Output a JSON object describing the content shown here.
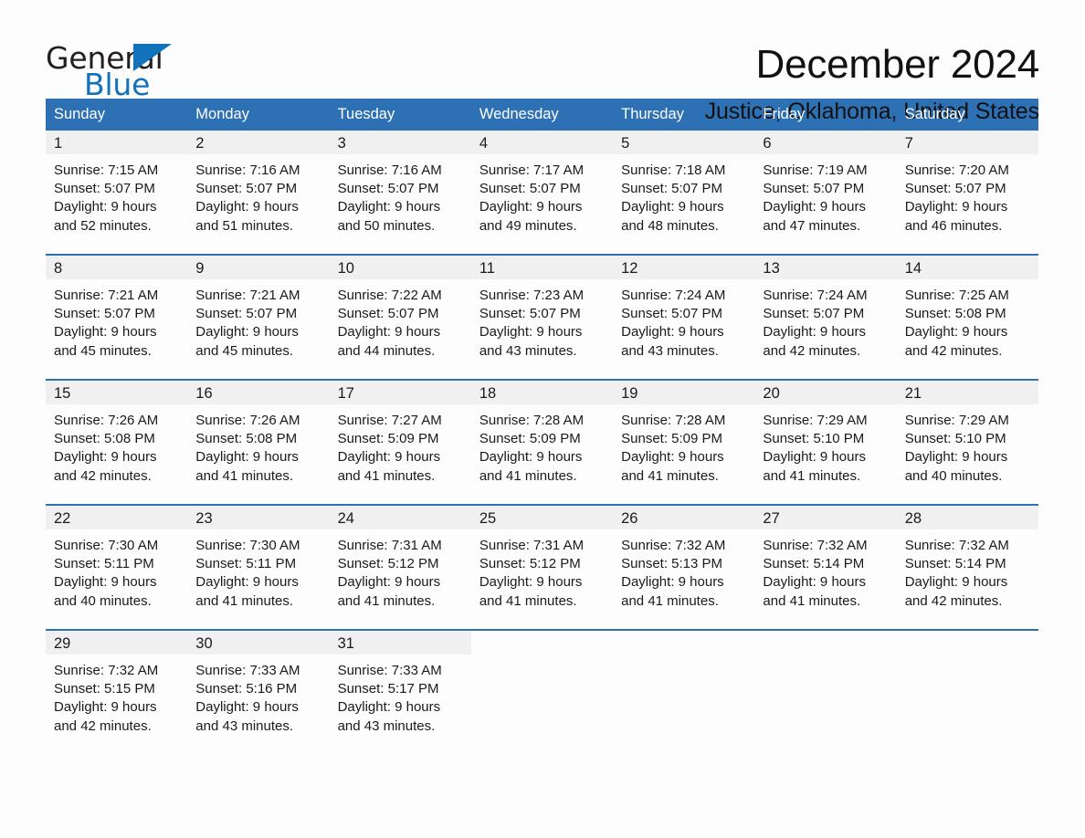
{
  "brand": {
    "name_part1": "General",
    "name_part2": "Blue"
  },
  "header": {
    "title": "December 2024",
    "subtitle": "Justice, Oklahoma, United States"
  },
  "colors": {
    "header_blue": "#2e70b4",
    "logo_blue": "#1272bb",
    "day_band_gray": "#f0f0f0",
    "page_background": "#fdfdfd"
  },
  "weekdays": [
    "Sunday",
    "Monday",
    "Tuesday",
    "Wednesday",
    "Thursday",
    "Friday",
    "Saturday"
  ],
  "weeks": [
    [
      {
        "day": "1",
        "sunrise": "Sunrise: 7:15 AM",
        "sunset": "Sunset: 5:07 PM",
        "daylight_line1": "Daylight: 9 hours",
        "daylight_line2": "and 52 minutes."
      },
      {
        "day": "2",
        "sunrise": "Sunrise: 7:16 AM",
        "sunset": "Sunset: 5:07 PM",
        "daylight_line1": "Daylight: 9 hours",
        "daylight_line2": "and 51 minutes."
      },
      {
        "day": "3",
        "sunrise": "Sunrise: 7:16 AM",
        "sunset": "Sunset: 5:07 PM",
        "daylight_line1": "Daylight: 9 hours",
        "daylight_line2": "and 50 minutes."
      },
      {
        "day": "4",
        "sunrise": "Sunrise: 7:17 AM",
        "sunset": "Sunset: 5:07 PM",
        "daylight_line1": "Daylight: 9 hours",
        "daylight_line2": "and 49 minutes."
      },
      {
        "day": "5",
        "sunrise": "Sunrise: 7:18 AM",
        "sunset": "Sunset: 5:07 PM",
        "daylight_line1": "Daylight: 9 hours",
        "daylight_line2": "and 48 minutes."
      },
      {
        "day": "6",
        "sunrise": "Sunrise: 7:19 AM",
        "sunset": "Sunset: 5:07 PM",
        "daylight_line1": "Daylight: 9 hours",
        "daylight_line2": "and 47 minutes."
      },
      {
        "day": "7",
        "sunrise": "Sunrise: 7:20 AM",
        "sunset": "Sunset: 5:07 PM",
        "daylight_line1": "Daylight: 9 hours",
        "daylight_line2": "and 46 minutes."
      }
    ],
    [
      {
        "day": "8",
        "sunrise": "Sunrise: 7:21 AM",
        "sunset": "Sunset: 5:07 PM",
        "daylight_line1": "Daylight: 9 hours",
        "daylight_line2": "and 45 minutes."
      },
      {
        "day": "9",
        "sunrise": "Sunrise: 7:21 AM",
        "sunset": "Sunset: 5:07 PM",
        "daylight_line1": "Daylight: 9 hours",
        "daylight_line2": "and 45 minutes."
      },
      {
        "day": "10",
        "sunrise": "Sunrise: 7:22 AM",
        "sunset": "Sunset: 5:07 PM",
        "daylight_line1": "Daylight: 9 hours",
        "daylight_line2": "and 44 minutes."
      },
      {
        "day": "11",
        "sunrise": "Sunrise: 7:23 AM",
        "sunset": "Sunset: 5:07 PM",
        "daylight_line1": "Daylight: 9 hours",
        "daylight_line2": "and 43 minutes."
      },
      {
        "day": "12",
        "sunrise": "Sunrise: 7:24 AM",
        "sunset": "Sunset: 5:07 PM",
        "daylight_line1": "Daylight: 9 hours",
        "daylight_line2": "and 43 minutes."
      },
      {
        "day": "13",
        "sunrise": "Sunrise: 7:24 AM",
        "sunset": "Sunset: 5:07 PM",
        "daylight_line1": "Daylight: 9 hours",
        "daylight_line2": "and 42 minutes."
      },
      {
        "day": "14",
        "sunrise": "Sunrise: 7:25 AM",
        "sunset": "Sunset: 5:08 PM",
        "daylight_line1": "Daylight: 9 hours",
        "daylight_line2": "and 42 minutes."
      }
    ],
    [
      {
        "day": "15",
        "sunrise": "Sunrise: 7:26 AM",
        "sunset": "Sunset: 5:08 PM",
        "daylight_line1": "Daylight: 9 hours",
        "daylight_line2": "and 42 minutes."
      },
      {
        "day": "16",
        "sunrise": "Sunrise: 7:26 AM",
        "sunset": "Sunset: 5:08 PM",
        "daylight_line1": "Daylight: 9 hours",
        "daylight_line2": "and 41 minutes."
      },
      {
        "day": "17",
        "sunrise": "Sunrise: 7:27 AM",
        "sunset": "Sunset: 5:09 PM",
        "daylight_line1": "Daylight: 9 hours",
        "daylight_line2": "and 41 minutes."
      },
      {
        "day": "18",
        "sunrise": "Sunrise: 7:28 AM",
        "sunset": "Sunset: 5:09 PM",
        "daylight_line1": "Daylight: 9 hours",
        "daylight_line2": "and 41 minutes."
      },
      {
        "day": "19",
        "sunrise": "Sunrise: 7:28 AM",
        "sunset": "Sunset: 5:09 PM",
        "daylight_line1": "Daylight: 9 hours",
        "daylight_line2": "and 41 minutes."
      },
      {
        "day": "20",
        "sunrise": "Sunrise: 7:29 AM",
        "sunset": "Sunset: 5:10 PM",
        "daylight_line1": "Daylight: 9 hours",
        "daylight_line2": "and 41 minutes."
      },
      {
        "day": "21",
        "sunrise": "Sunrise: 7:29 AM",
        "sunset": "Sunset: 5:10 PM",
        "daylight_line1": "Daylight: 9 hours",
        "daylight_line2": "and 40 minutes."
      }
    ],
    [
      {
        "day": "22",
        "sunrise": "Sunrise: 7:30 AM",
        "sunset": "Sunset: 5:11 PM",
        "daylight_line1": "Daylight: 9 hours",
        "daylight_line2": "and 40 minutes."
      },
      {
        "day": "23",
        "sunrise": "Sunrise: 7:30 AM",
        "sunset": "Sunset: 5:11 PM",
        "daylight_line1": "Daylight: 9 hours",
        "daylight_line2": "and 41 minutes."
      },
      {
        "day": "24",
        "sunrise": "Sunrise: 7:31 AM",
        "sunset": "Sunset: 5:12 PM",
        "daylight_line1": "Daylight: 9 hours",
        "daylight_line2": "and 41 minutes."
      },
      {
        "day": "25",
        "sunrise": "Sunrise: 7:31 AM",
        "sunset": "Sunset: 5:12 PM",
        "daylight_line1": "Daylight: 9 hours",
        "daylight_line2": "and 41 minutes."
      },
      {
        "day": "26",
        "sunrise": "Sunrise: 7:32 AM",
        "sunset": "Sunset: 5:13 PM",
        "daylight_line1": "Daylight: 9 hours",
        "daylight_line2": "and 41 minutes."
      },
      {
        "day": "27",
        "sunrise": "Sunrise: 7:32 AM",
        "sunset": "Sunset: 5:14 PM",
        "daylight_line1": "Daylight: 9 hours",
        "daylight_line2": "and 41 minutes."
      },
      {
        "day": "28",
        "sunrise": "Sunrise: 7:32 AM",
        "sunset": "Sunset: 5:14 PM",
        "daylight_line1": "Daylight: 9 hours",
        "daylight_line2": "and 42 minutes."
      }
    ],
    [
      {
        "day": "29",
        "sunrise": "Sunrise: 7:32 AM",
        "sunset": "Sunset: 5:15 PM",
        "daylight_line1": "Daylight: 9 hours",
        "daylight_line2": "and 42 minutes."
      },
      {
        "day": "30",
        "sunrise": "Sunrise: 7:33 AM",
        "sunset": "Sunset: 5:16 PM",
        "daylight_line1": "Daylight: 9 hours",
        "daylight_line2": "and 43 minutes."
      },
      {
        "day": "31",
        "sunrise": "Sunrise: 7:33 AM",
        "sunset": "Sunset: 5:17 PM",
        "daylight_line1": "Daylight: 9 hours",
        "daylight_line2": "and 43 minutes."
      },
      {
        "day": "",
        "sunrise": "",
        "sunset": "",
        "daylight_line1": "",
        "daylight_line2": ""
      },
      {
        "day": "",
        "sunrise": "",
        "sunset": "",
        "daylight_line1": "",
        "daylight_line2": ""
      },
      {
        "day": "",
        "sunrise": "",
        "sunset": "",
        "daylight_line1": "",
        "daylight_line2": ""
      },
      {
        "day": "",
        "sunrise": "",
        "sunset": "",
        "daylight_line1": "",
        "daylight_line2": ""
      }
    ]
  ]
}
